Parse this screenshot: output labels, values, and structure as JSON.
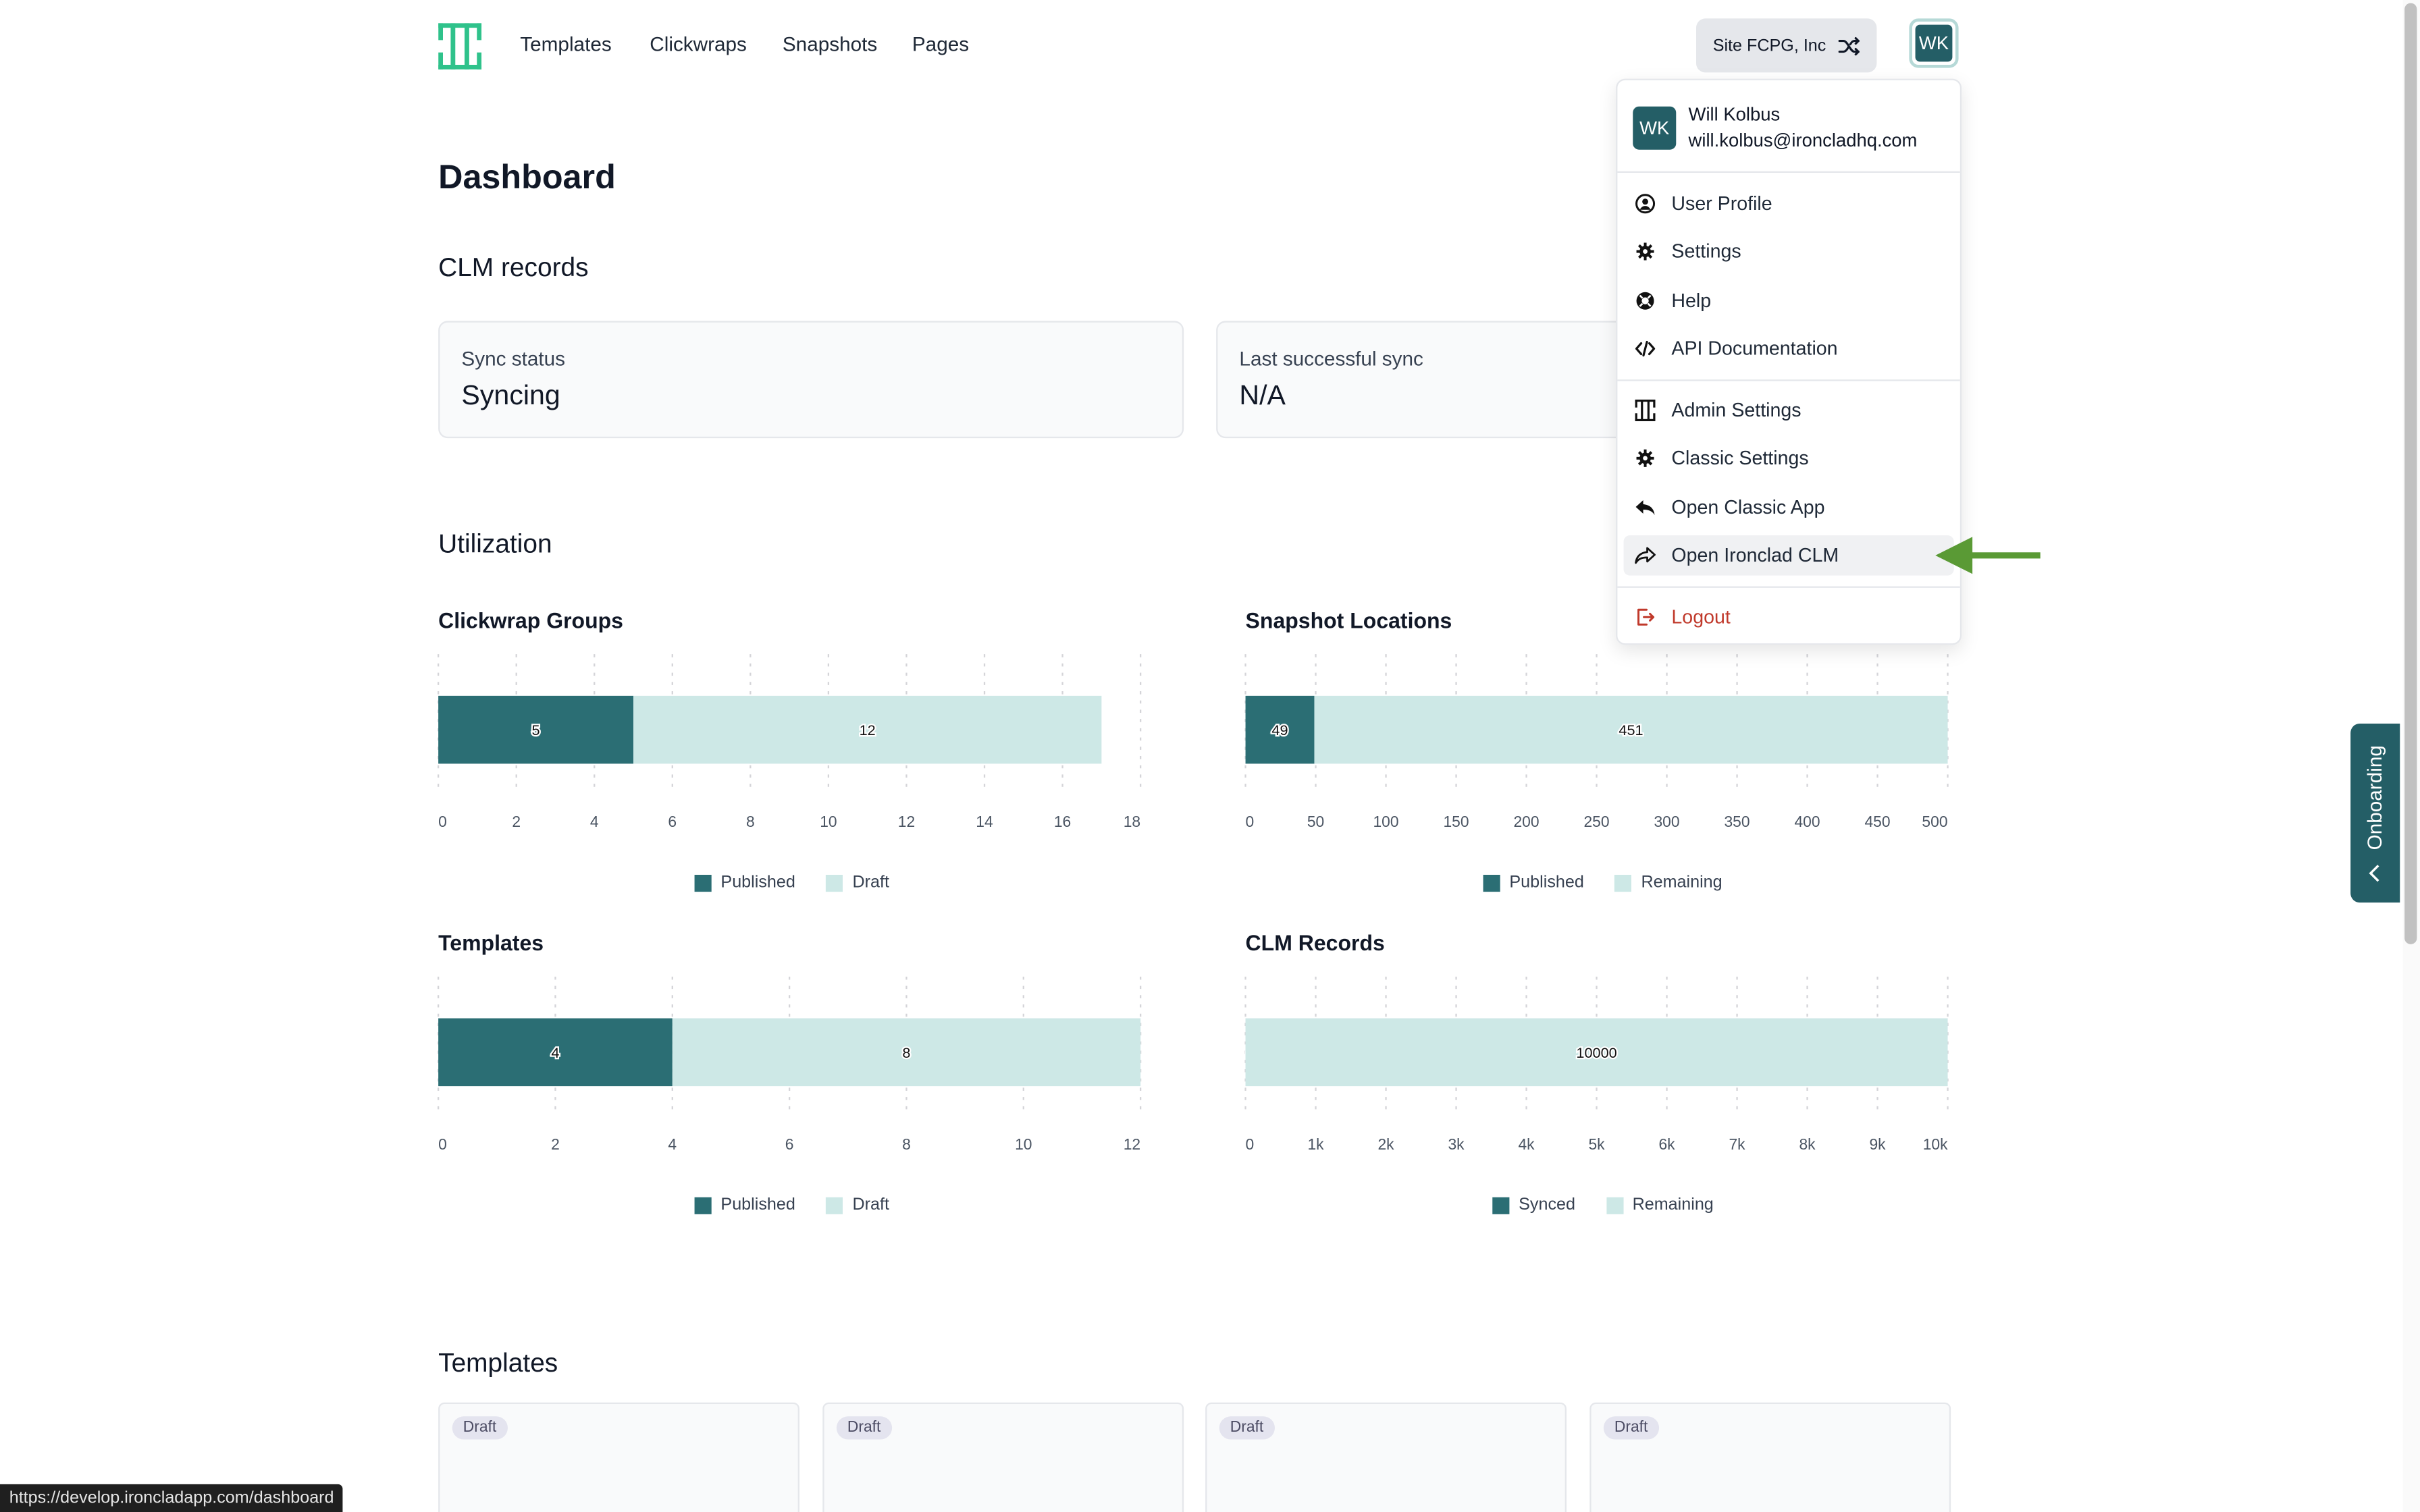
{
  "nav": {
    "links": [
      "Templates",
      "Clickwraps",
      "Snapshots",
      "Pages"
    ],
    "site_label": "Site FCPG, Inc",
    "avatar_initials": "WK"
  },
  "page": {
    "title": "Dashboard",
    "clm_section": "CLM records",
    "utilization_section": "Utilization",
    "templates_section": "Templates"
  },
  "cards": [
    {
      "label": "Sync status",
      "value": "Syncing"
    },
    {
      "label": "Last successful sync",
      "value": "N/A"
    }
  ],
  "colors": {
    "primary": "#2b6e74",
    "light": "#cde8e6",
    "danger": "#c0392b",
    "arrow": "#5a9a35"
  },
  "chart_data": [
    {
      "type": "bar",
      "title": "Clickwrap Groups",
      "orientation": "horizontal-stacked",
      "series": [
        {
          "name": "Published",
          "values": [
            5
          ]
        },
        {
          "name": "Draft",
          "values": [
            12
          ]
        }
      ],
      "xticks": [
        "0",
        "2",
        "4",
        "6",
        "8",
        "10",
        "12",
        "14",
        "16",
        "18"
      ],
      "xlim": [
        0,
        18
      ]
    },
    {
      "type": "bar",
      "title": "Snapshot Locations",
      "orientation": "horizontal-stacked",
      "series": [
        {
          "name": "Published",
          "values": [
            49
          ]
        },
        {
          "name": "Remaining",
          "values": [
            451
          ]
        }
      ],
      "xticks": [
        "0",
        "50",
        "100",
        "150",
        "200",
        "250",
        "300",
        "350",
        "400",
        "450",
        "500"
      ],
      "xlim": [
        0,
        500
      ]
    },
    {
      "type": "bar",
      "title": "Templates",
      "orientation": "horizontal-stacked",
      "series": [
        {
          "name": "Published",
          "values": [
            4
          ]
        },
        {
          "name": "Draft",
          "values": [
            8
          ]
        }
      ],
      "xticks": [
        "0",
        "2",
        "4",
        "6",
        "8",
        "10",
        "12"
      ],
      "xlim": [
        0,
        12
      ]
    },
    {
      "type": "bar",
      "title": "CLM Records",
      "orientation": "horizontal-stacked",
      "series": [
        {
          "name": "Synced",
          "values": [
            0
          ]
        },
        {
          "name": "Remaining",
          "values": [
            10000
          ]
        }
      ],
      "xticks": [
        "0",
        "1k",
        "2k",
        "3k",
        "4k",
        "5k",
        "6k",
        "7k",
        "8k",
        "9k",
        "10k"
      ],
      "xlim": [
        0,
        10000
      ]
    }
  ],
  "template_cards": [
    "Draft",
    "Draft",
    "Draft",
    "Draft"
  ],
  "dropdown": {
    "user_name": "Will Kolbus",
    "user_email": "will.kolbus@ironcladhq.com",
    "group1": [
      {
        "label": "User Profile",
        "icon": "user-circle-icon"
      },
      {
        "label": "Settings",
        "icon": "gear-icon"
      },
      {
        "label": "Help",
        "icon": "lifebuoy-icon"
      },
      {
        "label": "API Documentation",
        "icon": "code-icon"
      }
    ],
    "group2": [
      {
        "label": "Admin Settings",
        "icon": "ironclad-logo-icon"
      },
      {
        "label": "Classic Settings",
        "icon": "gear-icon"
      },
      {
        "label": "Open Classic App",
        "icon": "reply-icon"
      },
      {
        "label": "Open Ironclad CLM",
        "icon": "share-forward-icon"
      }
    ],
    "logout": "Logout"
  },
  "onboarding": "Onboarding",
  "status_url": "https://develop.ironcladapp.com/dashboard"
}
